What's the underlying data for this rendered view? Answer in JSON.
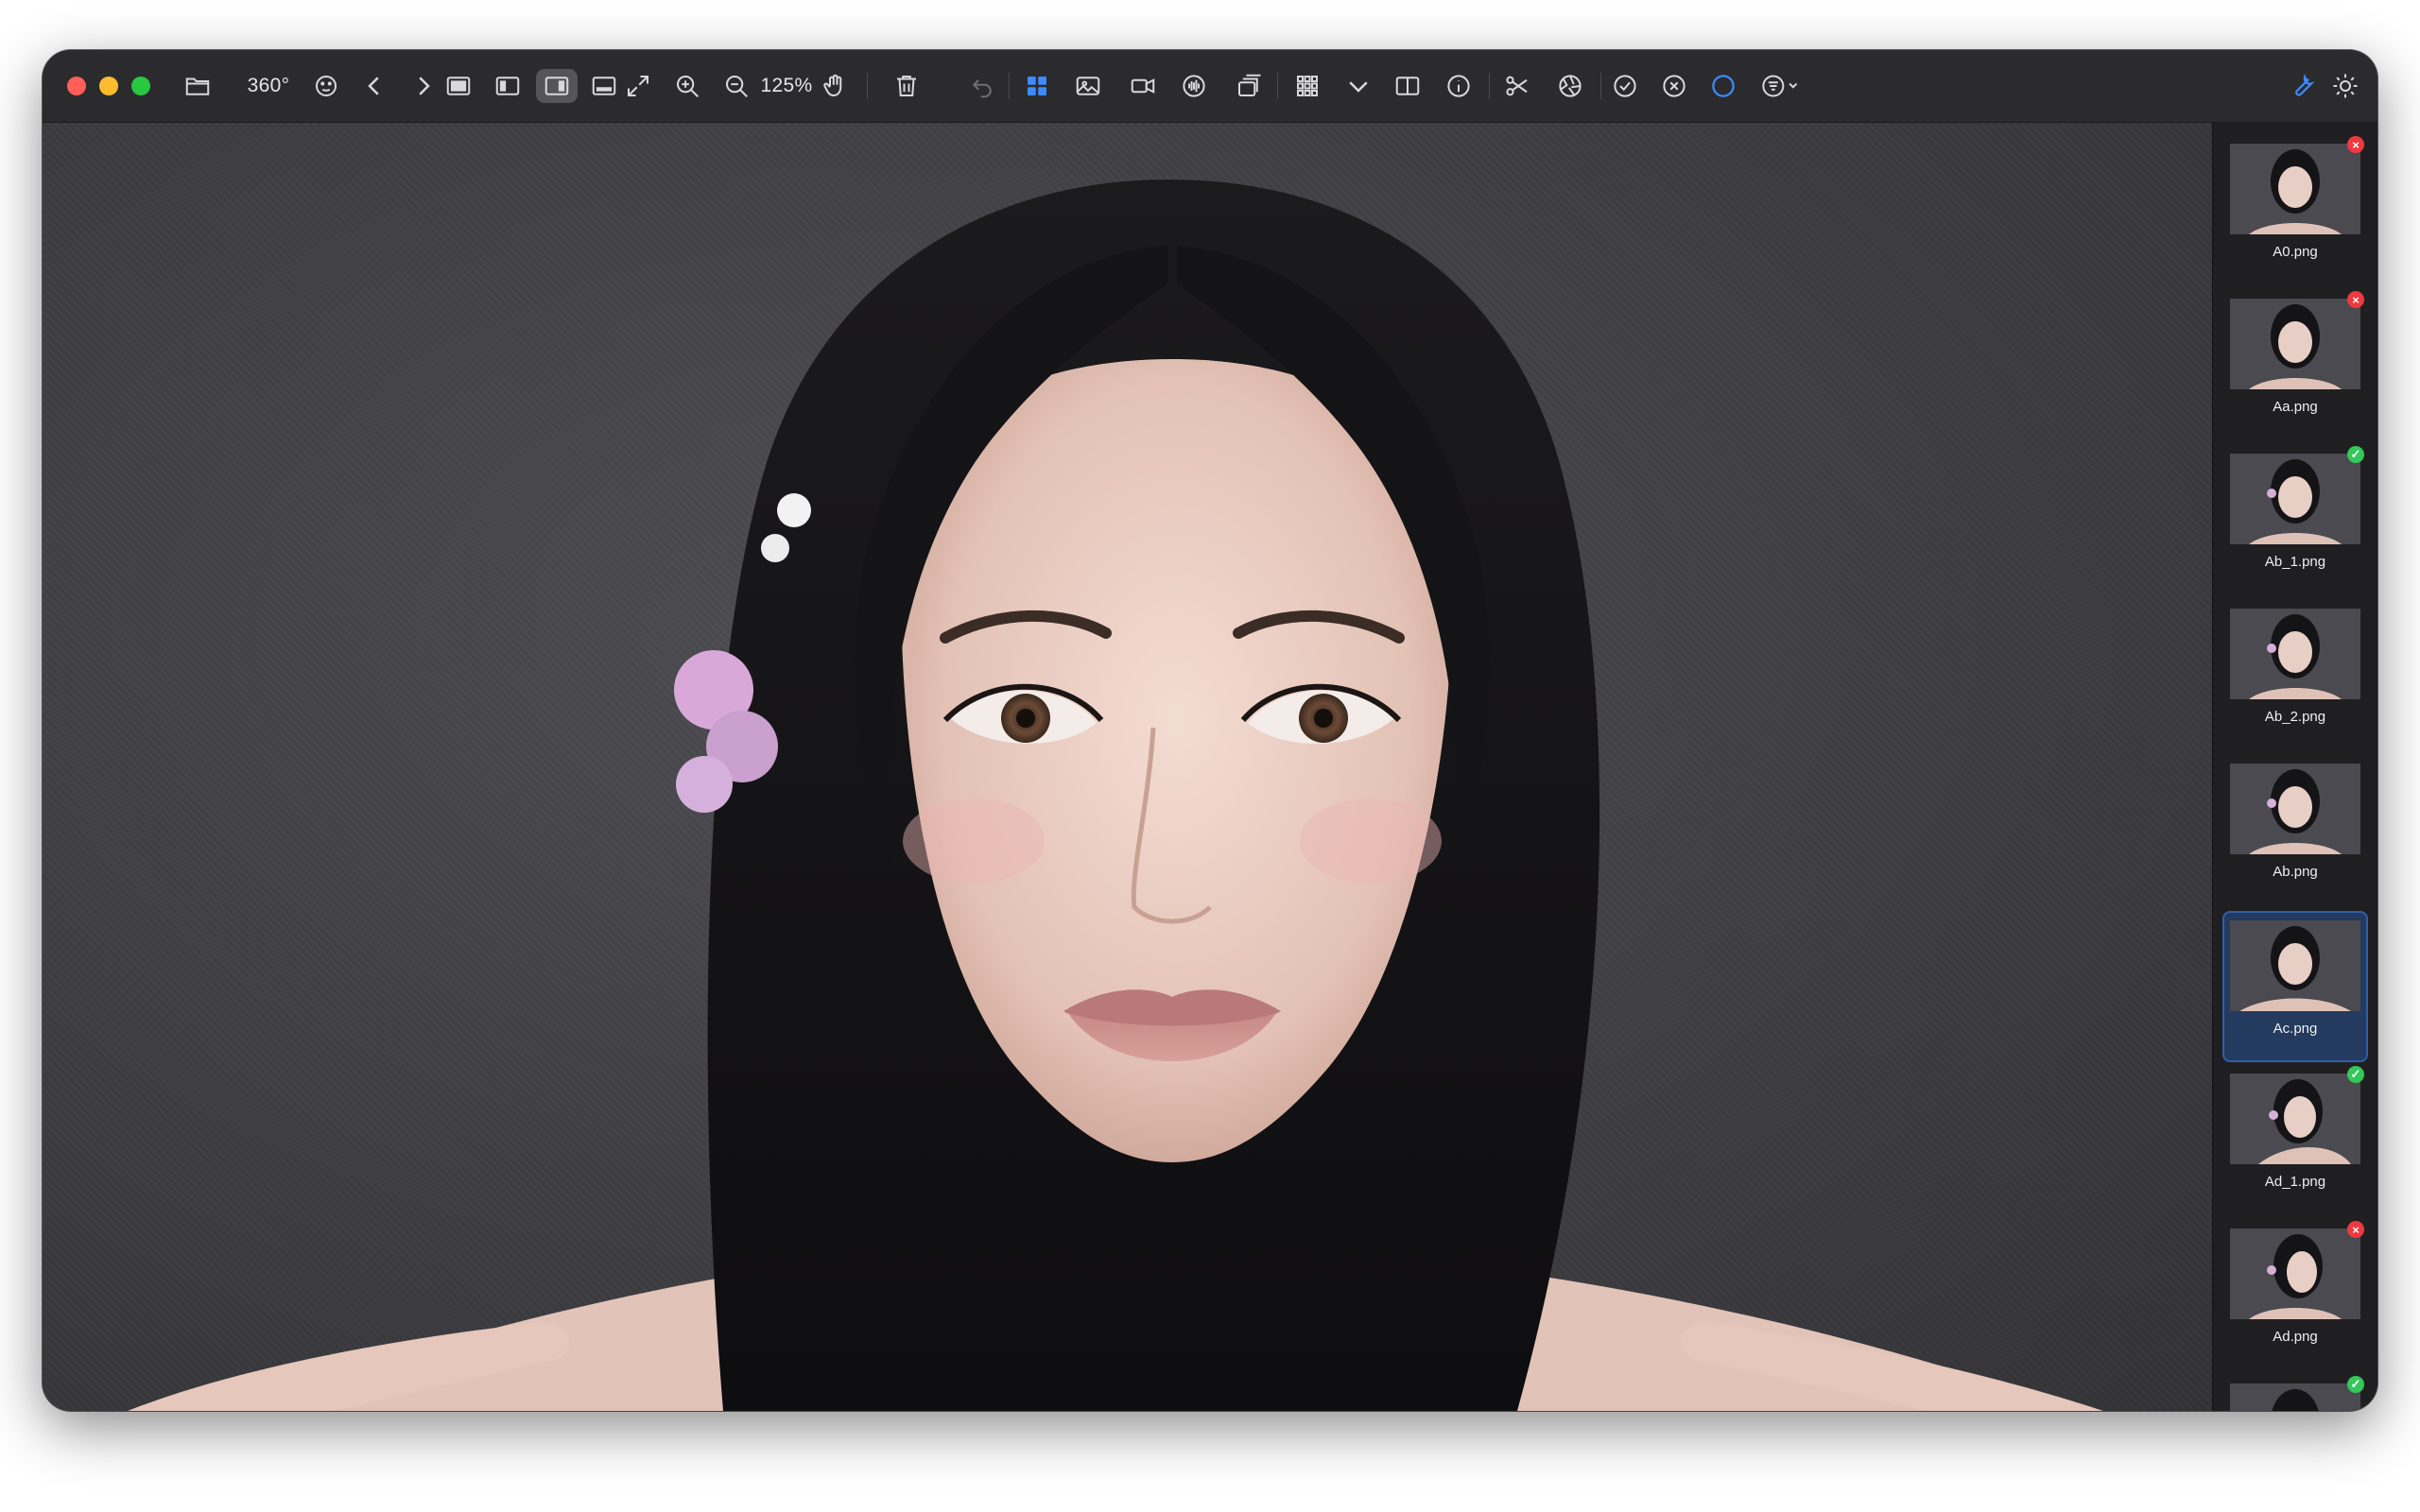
{
  "toolbar": {
    "rotate_label": "360°",
    "zoom_value": "125%"
  },
  "sidebar": {
    "items": [
      {
        "name": "A0.png",
        "status": "rejected"
      },
      {
        "name": "Aa.png",
        "status": "rejected"
      },
      {
        "name": "Ab_1.png",
        "status": "accepted"
      },
      {
        "name": "Ab_2.png",
        "status": "none"
      },
      {
        "name": "Ab.png",
        "status": "none"
      },
      {
        "name": "Ac.png",
        "status": "selected"
      },
      {
        "name": "Ad_1.png",
        "status": "accepted"
      },
      {
        "name": "Ad.png",
        "status": "rejected"
      }
    ]
  },
  "colors": {
    "accent": "#3d8bff",
    "reject": "#f0383f",
    "accept": "#34c759",
    "selected_bg": "#243a5e"
  },
  "icons": [
    "folder-icon",
    "rotate-icon",
    "face-icon",
    "chevron-left-icon",
    "chevron-right-icon",
    "layout-single-icon",
    "layout-left-icon",
    "layout-right-icon",
    "layout-bottom-icon",
    "expand-icon",
    "zoom-in-icon",
    "zoom-out-icon",
    "hand-icon",
    "trash-icon",
    "undo-icon",
    "grid-icon",
    "image-icon",
    "video-icon",
    "audio-icon",
    "stack-icon",
    "apps-icon",
    "chevron-down-icon",
    "split-icon",
    "info-icon",
    "scissors-icon",
    "aperture-icon",
    "check-circle-icon",
    "x-circle-icon",
    "circle-icon",
    "filter-icon",
    "wrench-icon",
    "sun-icon"
  ]
}
